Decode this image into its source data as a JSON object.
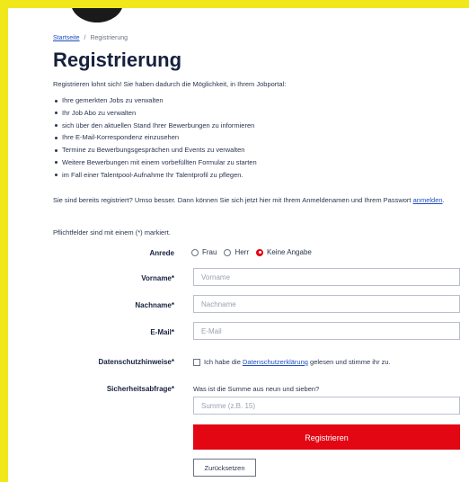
{
  "breadcrumb": {
    "home": "Startseite",
    "separator": "/",
    "current": "Registrierung"
  },
  "page": {
    "title": "Registrierung",
    "intro": "Registrieren lohnt sich! Sie haben dadurch die Möglichkeit, in Ihrem Jobportal:",
    "benefits": [
      "Ihre gemerkten Jobs zu verwalten",
      "Ihr Job Abo zu verwalten",
      "sich über den aktuellen Stand Ihrer Bewerbungen zu informieren",
      "Ihre E-Mail-Korrespondenz einzusehen",
      "Termine zu Bewerbungsgesprächen und Events zu verwalten",
      "Weitere Bewerbungen mit einem vorbefüllten Formular zu starten",
      "im Fall einer Talentpool-Aufnahme Ihr Talentprofil zu pflegen."
    ],
    "already_text": "Sie sind bereits registriert? Umso besser. Dann können Sie sich jetzt hier mit Ihrem Anmeldenamen und Ihrem Passwort",
    "already_link": "anmelden",
    "already_end": ".",
    "required_note": "Pflichtfelder sind mit einem (*) markiert."
  },
  "form": {
    "salutation": {
      "label": "Anrede",
      "options": [
        "Frau",
        "Herr",
        "Keine Angabe"
      ],
      "selected": "Keine Angabe"
    },
    "firstname": {
      "label": "Vorname",
      "star": "*",
      "placeholder": "Vorname",
      "value": ""
    },
    "lastname": {
      "label": "Nachname",
      "star": "*",
      "placeholder": "Nachname",
      "value": ""
    },
    "email": {
      "label": "E-Mail",
      "star": "*",
      "placeholder": "E-Mail",
      "value": ""
    },
    "privacy": {
      "label": "Datenschutzhinweise",
      "star": "*",
      "text_before": "Ich habe die",
      "link": "Datenschutzerklärung",
      "text_after": "gelesen und stimme ihr zu.",
      "checked": false
    },
    "security": {
      "label": "Sicherheitsabfrage",
      "star": "*",
      "question": "Was ist die Summe aus neun und sieben?",
      "placeholder": "Summe (z.B. 15)",
      "value": ""
    },
    "submit_label": "Registrieren",
    "reset_label": "Zurücksetzen"
  },
  "colors": {
    "frame": "#f0e81a",
    "accent_red": "#e30613",
    "link_blue": "#1f4fbf",
    "heading_navy": "#16213d"
  }
}
